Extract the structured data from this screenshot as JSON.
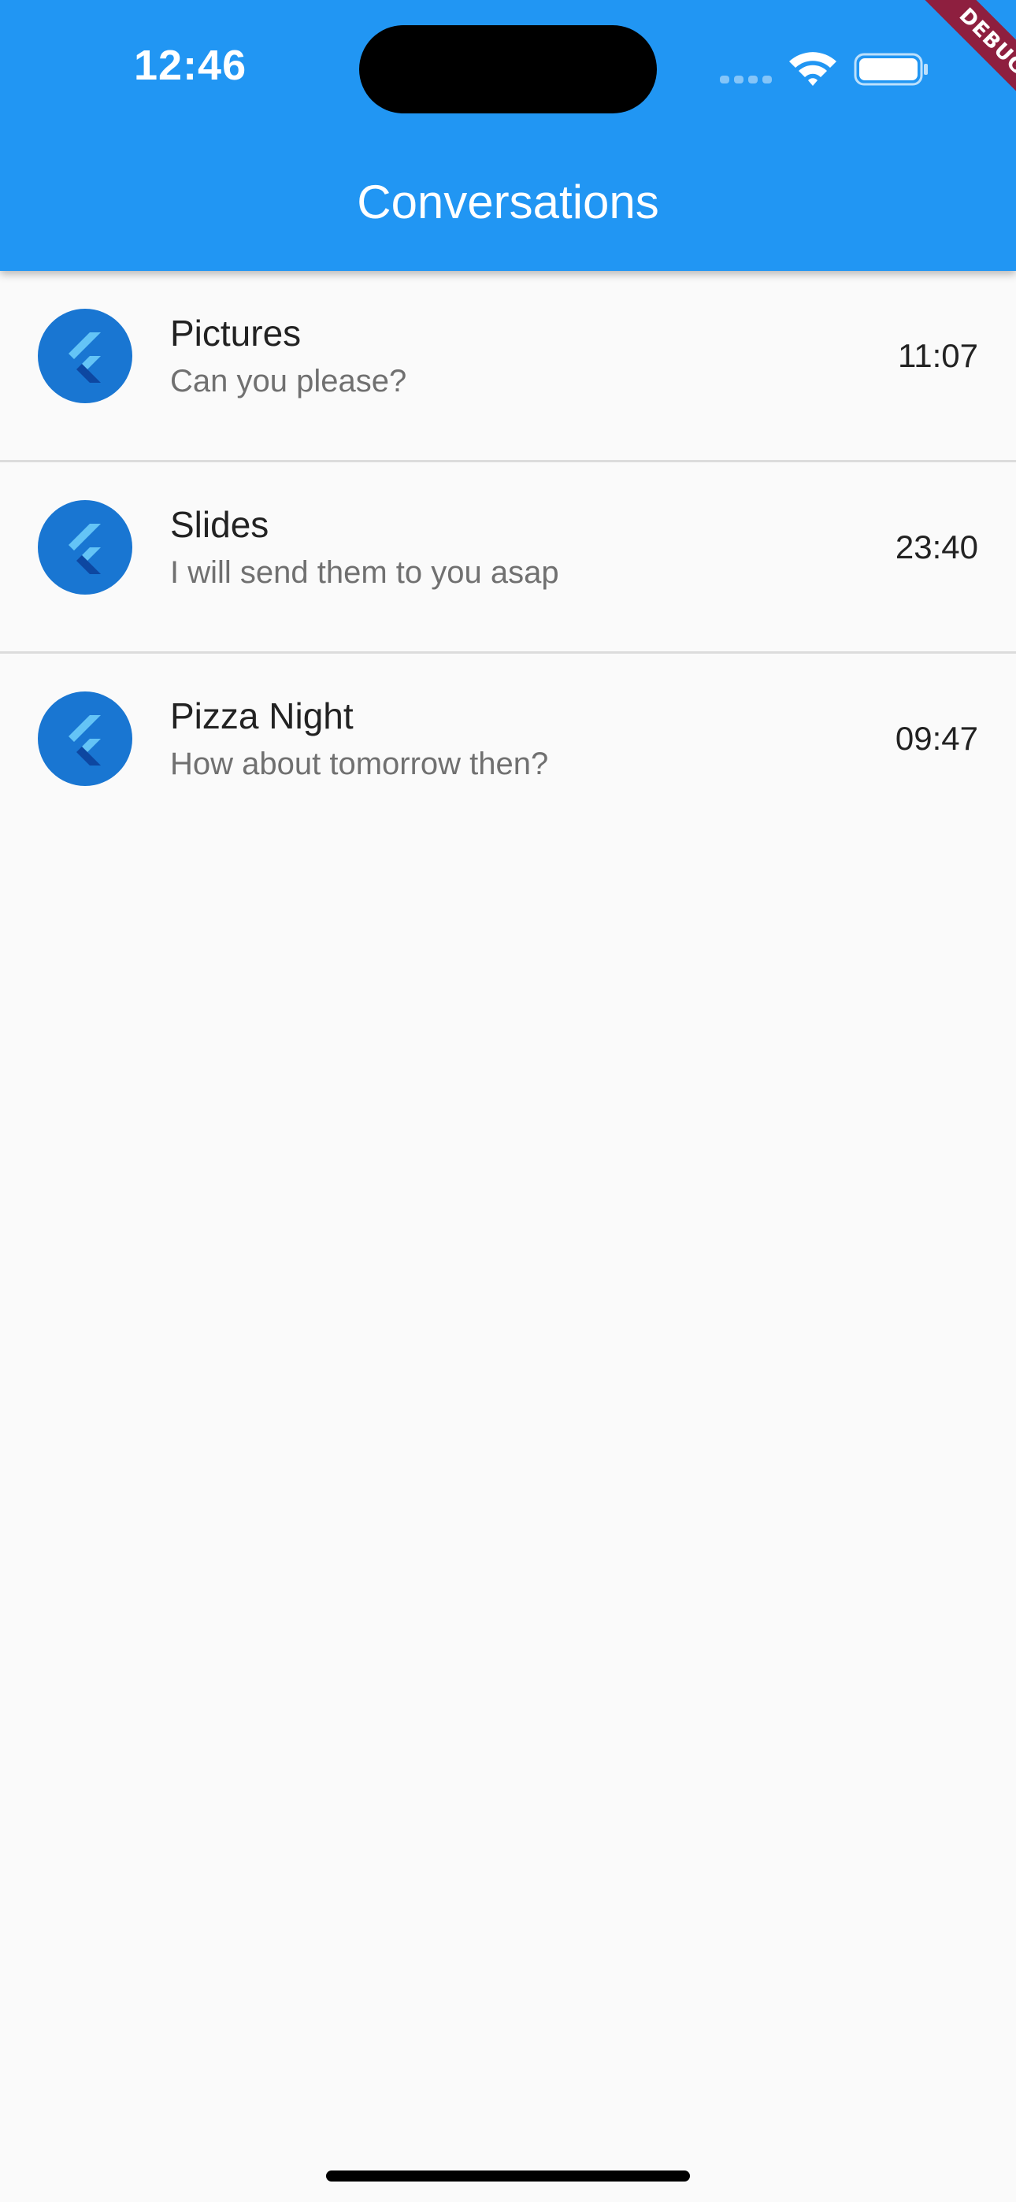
{
  "status_bar": {
    "time": "12:46"
  },
  "debug_banner": {
    "label": "DEBUG"
  },
  "app_bar": {
    "title": "Conversations",
    "color": "#2196f3"
  },
  "conversations": [
    {
      "title": "Pictures",
      "subtitle": "Can you please?",
      "time": "11:07"
    },
    {
      "title": "Slides",
      "subtitle": "I will send them to you asap",
      "time": "23:40"
    },
    {
      "title": "Pizza Night",
      "subtitle": "How about tomorrow then?",
      "time": "09:47"
    }
  ],
  "icons": {
    "avatar": "flutter-logo-icon",
    "wifi": "wifi-icon",
    "battery": "battery-icon",
    "signal": "cellular-signal-icon"
  },
  "colors": {
    "avatar_bg": "#1976d2",
    "background": "#fafafa",
    "debug_ribbon": "#8e1f3f"
  }
}
